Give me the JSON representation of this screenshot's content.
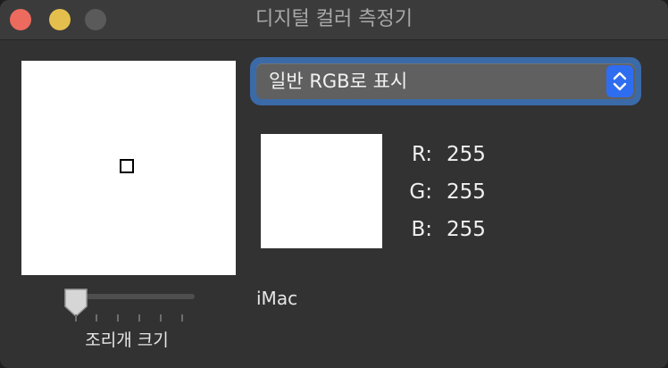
{
  "window": {
    "title": "디지털 컬러 측정기",
    "traffic_lights": [
      "close",
      "minimize",
      "zoom"
    ]
  },
  "loupe": {
    "icon": "sample-square-icon"
  },
  "aperture": {
    "label": "조리개 크기",
    "value_fraction": 0.0,
    "tick_count": 6
  },
  "display_mode": {
    "selected": "일반 RGB로 표시"
  },
  "color": {
    "swatch_hex": "#ffffff",
    "r_label": "R:",
    "r_value": "255",
    "g_label": "G:",
    "g_value": "255",
    "b_label": "B:",
    "b_value": "255"
  },
  "display_name": "iMac",
  "colors": {
    "accent": "#2f6df0",
    "focus_ring": "#3b6aa8",
    "close": "#ed6a5e",
    "minimize": "#e5bf4d",
    "zoom": "#5a5a5a"
  }
}
